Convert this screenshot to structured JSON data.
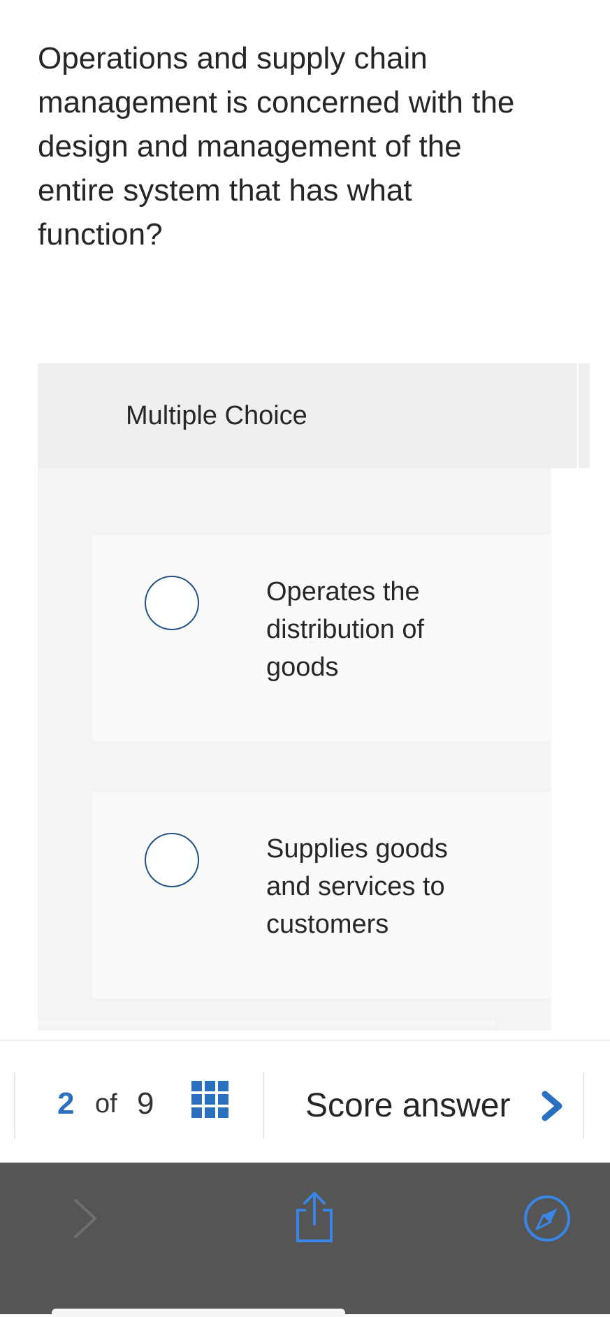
{
  "question": {
    "text": "Operations and supply chain management is concerned with the design and management of the entire system that has what function?"
  },
  "multiple_choice": {
    "title": "Multiple Choice",
    "options": [
      {
        "label": "Operates the distribution of goods"
      },
      {
        "label": "Supplies goods and services to customers"
      }
    ]
  },
  "footer": {
    "pager": {
      "current": "2",
      "of_label": "of",
      "total": "9"
    },
    "score_answer_label": "Score answer"
  },
  "colors": {
    "accent": "#2a6fc0",
    "radio_border": "#1f4e87",
    "safari_bar": "#555555"
  },
  "icons": {
    "pager_grid": "grid-icon",
    "score_chevron": "chevron-right-icon",
    "browser_forward": "chevron-right-icon",
    "browser_share": "share-icon",
    "browser_compass": "compass-icon"
  }
}
